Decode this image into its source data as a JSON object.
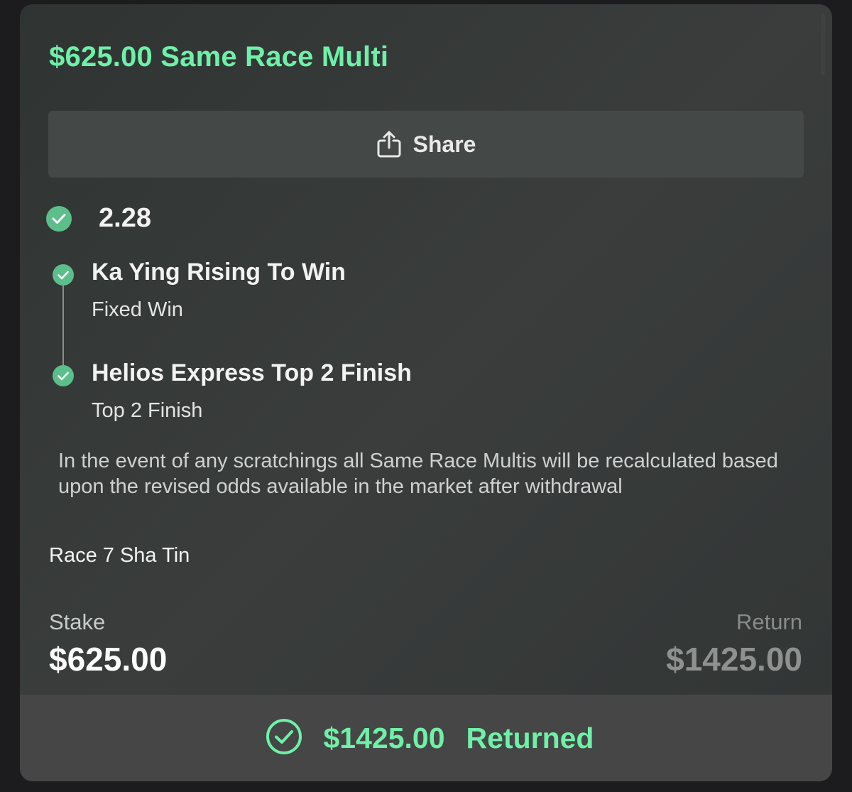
{
  "bet": {
    "title": "$625.00 Same Race Multi",
    "share_label": "Share",
    "odds": "2.28",
    "legs": [
      {
        "title": "Ka Ying Rising To Win",
        "subtitle": "Fixed Win"
      },
      {
        "title": "Helios Express Top 2 Finish",
        "subtitle": "Top 2 Finish"
      }
    ],
    "disclaimer": "In the event of any scratchings all Same Race Multis will be recalculated based upon the revised odds available in the market after withdrawal",
    "race": "Race 7 Sha Tin",
    "stake_label": "Stake",
    "stake_value": "$625.00",
    "return_label": "Return",
    "return_value": "$1425.00"
  },
  "footer": {
    "amount": "$1425.00",
    "status": "Returned"
  },
  "icons": {
    "share": "share-icon",
    "check": "check-circle-icon",
    "returned": "check-circle-outline-icon"
  },
  "colors": {
    "accent": "#6ff0a8",
    "check": "#5cbf8b",
    "card": "#353938",
    "footer": "#454645"
  }
}
